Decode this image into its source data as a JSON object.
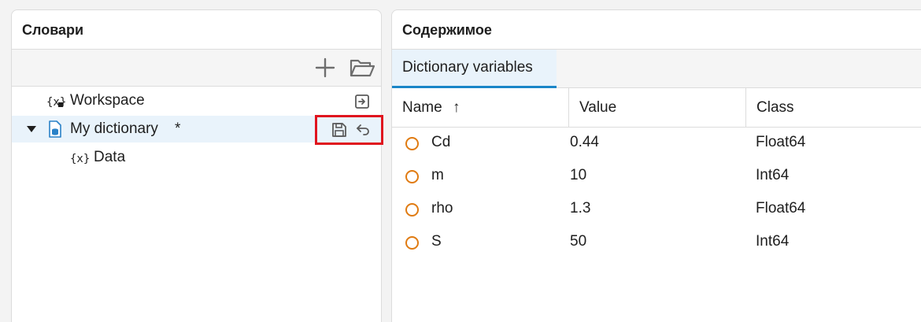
{
  "left_panel": {
    "title": "Словари",
    "tree": {
      "workspace": {
        "label": "Workspace"
      },
      "dictionary": {
        "label": "My dictionary",
        "modified_marker": "*"
      },
      "child": {
        "label": "Data"
      }
    }
  },
  "right_panel": {
    "title": "Содержимое",
    "tab": "Dictionary variables",
    "columns": {
      "name": "Name",
      "sort_arrow": "↑",
      "value": "Value",
      "class": "Class"
    },
    "rows": [
      {
        "name": "Cd",
        "value": "0.44",
        "class": "Float64"
      },
      {
        "name": "m",
        "value": "10",
        "class": "Int64"
      },
      {
        "name": "rho",
        "value": "1.3",
        "class": "Float64"
      },
      {
        "name": "S",
        "value": "50",
        "class": "Int64"
      }
    ]
  },
  "colors": {
    "accent": "#1a86c8",
    "variable_icon": "#e07b12",
    "highlight": "#e0141e",
    "selected_row": "#e9f3fb"
  },
  "icons": [
    "plus-icon",
    "folder-open-icon",
    "variable-icon",
    "export-icon",
    "dictionary-file-icon",
    "save-icon",
    "revert-icon",
    "caret-down-icon",
    "sort-up-arrow-icon"
  ]
}
